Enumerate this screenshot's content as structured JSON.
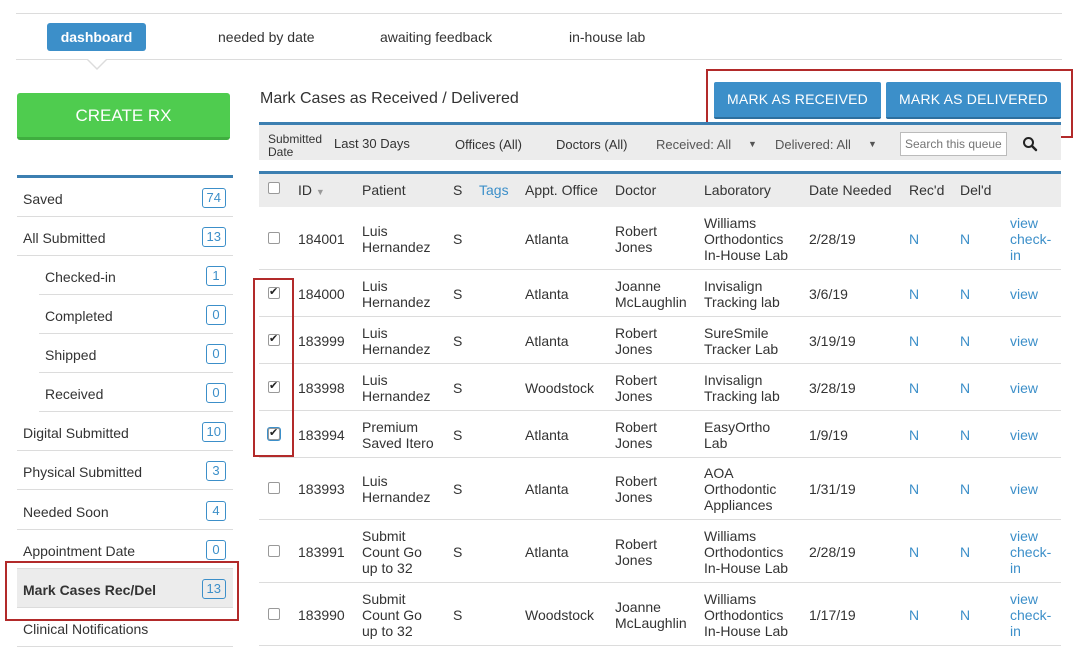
{
  "nav": {
    "tabs": [
      "dashboard",
      "needed by date",
      "awaiting feedback",
      "in-house lab"
    ]
  },
  "sidebar": {
    "create_label": "CREATE RX",
    "items": [
      {
        "label": "Saved",
        "count": "74"
      },
      {
        "label": "All Submitted",
        "count": "13"
      },
      {
        "label": "Checked-in",
        "count": "1"
      },
      {
        "label": "Completed",
        "count": "0"
      },
      {
        "label": "Shipped",
        "count": "0"
      },
      {
        "label": "Received",
        "count": "0"
      },
      {
        "label": "Digital Submitted",
        "count": "10"
      },
      {
        "label": "Physical Submitted",
        "count": "3"
      },
      {
        "label": "Needed Soon",
        "count": "4"
      },
      {
        "label": "Appointment Date",
        "count": "0"
      },
      {
        "label": "Mark Cases Rec/Del",
        "count": "13"
      },
      {
        "label": "Clinical Notifications",
        "count": ""
      }
    ]
  },
  "main": {
    "title": "Mark Cases as Received / Delivered",
    "mark_received_label": "MARK AS RECEIVED",
    "mark_delivered_label": "MARK AS DELIVERED"
  },
  "filters": {
    "submitted_label_1": "Submitted",
    "submitted_label_2": "Date",
    "submitted_value": "Last 30 Days",
    "offices": "Offices (All)",
    "doctors": "Doctors (All)",
    "received_label": "Received:",
    "received_value": "All",
    "delivered_label": "Delivered:",
    "delivered_value": "All",
    "search_placeholder": "Search this queue"
  },
  "table": {
    "headers": {
      "id": "ID",
      "patient": "Patient",
      "s": "S",
      "tags": "Tags",
      "office": "Appt. Office",
      "doctor": "Doctor",
      "lab": "Laboratory",
      "date": "Date Needed",
      "recd": "Rec'd",
      "deld": "Del'd"
    },
    "rows": [
      {
        "id": "184001",
        "patient": [
          "Luis",
          "Hernandez"
        ],
        "s": "S",
        "office": "Atlanta",
        "doctor": [
          "Robert",
          "Jones"
        ],
        "lab": [
          "Williams",
          "Orthodontics",
          "In-House Lab"
        ],
        "date": "2/28/19",
        "recd": "N",
        "deld": "N",
        "actions": [
          "view",
          "check-",
          "in"
        ],
        "checked": false
      },
      {
        "id": "184000",
        "patient": [
          "Luis",
          "Hernandez"
        ],
        "s": "S",
        "office": "Atlanta",
        "doctor": [
          "Joanne",
          "McLaughlin"
        ],
        "lab": [
          "Invisalign",
          "Tracking lab"
        ],
        "date": "3/6/19",
        "recd": "N",
        "deld": "N",
        "actions": [
          "view"
        ],
        "checked": true
      },
      {
        "id": "183999",
        "patient": [
          "Luis",
          "Hernandez"
        ],
        "s": "S",
        "office": "Atlanta",
        "doctor": [
          "Robert",
          "Jones"
        ],
        "lab": [
          "SureSmile",
          "Tracker Lab"
        ],
        "date": "3/19/19",
        "recd": "N",
        "deld": "N",
        "actions": [
          "view"
        ],
        "checked": true
      },
      {
        "id": "183998",
        "patient": [
          "Luis",
          "Hernandez"
        ],
        "s": "S",
        "office": "Woodstock",
        "doctor": [
          "Robert",
          "Jones"
        ],
        "lab": [
          "Invisalign",
          "Tracking lab"
        ],
        "date": "3/28/19",
        "recd": "N",
        "deld": "N",
        "actions": [
          "view"
        ],
        "checked": true
      },
      {
        "id": "183994",
        "patient": [
          "Premium",
          "Saved Itero"
        ],
        "s": "S",
        "office": "Atlanta",
        "doctor": [
          "Robert",
          "Jones"
        ],
        "lab": [
          "EasyOrtho",
          "Lab"
        ],
        "date": "1/9/19",
        "recd": "N",
        "deld": "N",
        "actions": [
          "view"
        ],
        "checked": true
      },
      {
        "id": "183993",
        "patient": [
          "Luis",
          "Hernandez"
        ],
        "s": "S",
        "office": "Atlanta",
        "doctor": [
          "Robert",
          "Jones"
        ],
        "lab": [
          "AOA",
          "Orthodontic",
          "Appliances"
        ],
        "date": "1/31/19",
        "recd": "N",
        "deld": "N",
        "actions": [
          "view"
        ],
        "checked": false
      },
      {
        "id": "183991",
        "patient": [
          "Submit",
          "Count Go",
          "up to 32"
        ],
        "s": "S",
        "office": "Atlanta",
        "doctor": [
          "Robert",
          "Jones"
        ],
        "lab": [
          "Williams",
          "Orthodontics",
          "In-House Lab"
        ],
        "date": "2/28/19",
        "recd": "N",
        "deld": "N",
        "actions": [
          "view",
          "check-",
          "in"
        ],
        "checked": false
      },
      {
        "id": "183990",
        "patient": [
          "Submit",
          "Count Go",
          "up to 32"
        ],
        "s": "S",
        "office": "Woodstock",
        "doctor": [
          "Joanne",
          "McLaughlin"
        ],
        "lab": [
          "Williams",
          "Orthodontics",
          "In-House Lab"
        ],
        "date": "1/17/19",
        "recd": "N",
        "deld": "N",
        "actions": [
          "view",
          "check-",
          "in"
        ],
        "checked": false
      }
    ]
  },
  "colors": {
    "accent": "#3c8fc9",
    "create": "#4fcc4f",
    "highlight_box": "#b22a2a"
  }
}
